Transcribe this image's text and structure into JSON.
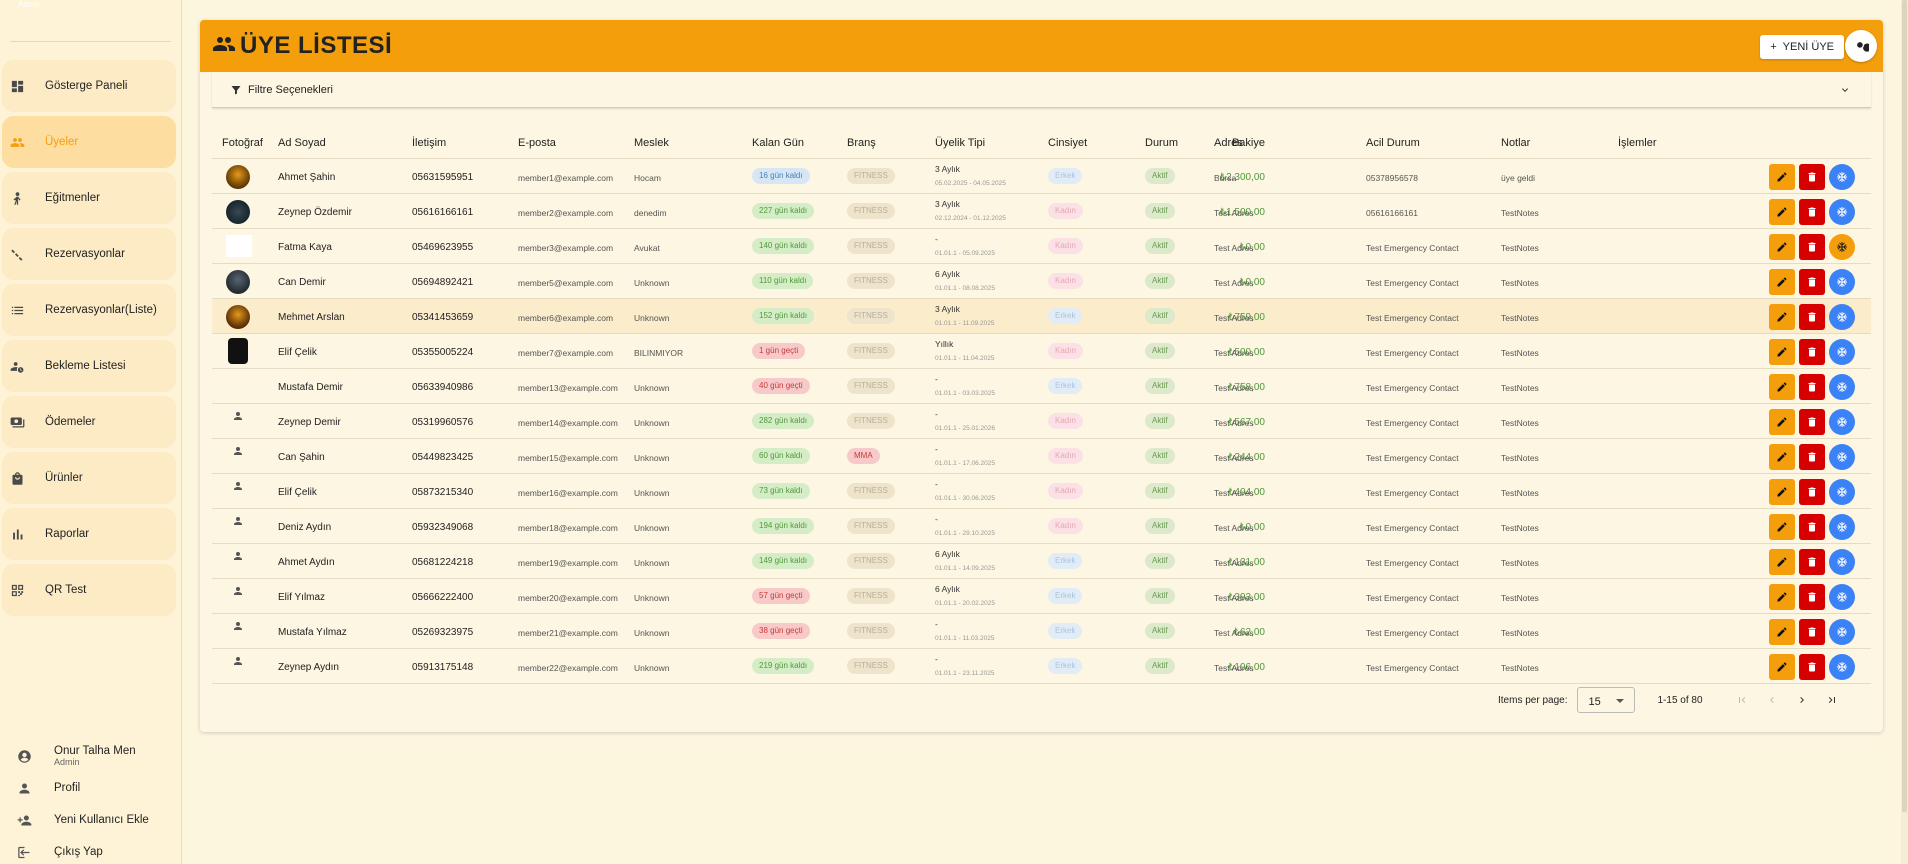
{
  "sidebar": {
    "brand_small": "Admin",
    "items": [
      {
        "label": "Gösterge Paneli",
        "icon": "dashboard-icon",
        "active": false
      },
      {
        "label": "Üyeler",
        "icon": "people-icon",
        "active": true
      },
      {
        "label": "Eğitmenler",
        "icon": "trainer-icon",
        "active": false
      },
      {
        "label": "Rezervasyonlar",
        "icon": "calendar-icon",
        "active": false
      },
      {
        "label": "Rezervasyonlar(Liste)",
        "icon": "list-icon",
        "active": false
      },
      {
        "label": "Bekleme Listesi",
        "icon": "waiting-icon",
        "active": false
      },
      {
        "label": "Ödemeler",
        "icon": "payment-icon",
        "active": false
      },
      {
        "label": "Ürünler",
        "icon": "bag-icon",
        "active": false
      },
      {
        "label": "Raporlar",
        "icon": "chart-icon",
        "active": false
      },
      {
        "label": "QR Test",
        "icon": "qr-icon",
        "active": false
      }
    ],
    "user": {
      "name": "Onur Talha Men",
      "role": "Admin"
    },
    "links": [
      {
        "label": "Profil",
        "icon": "person-icon"
      },
      {
        "label": "Yeni Kullanıcı Ekle",
        "icon": "person-add-icon"
      },
      {
        "label": "Çıkış Yap",
        "icon": "logout-icon"
      }
    ]
  },
  "header": {
    "title": "ÜYE LİSTESİ",
    "new_button": "YENİ ÜYE",
    "accent": "#f59e0b"
  },
  "filter": {
    "label": "Filtre Seçenekleri"
  },
  "table": {
    "columns": [
      "Fotoğraf",
      "Ad Soyad",
      "İletişim",
      "E-posta",
      "Meslek",
      "Kalan Gün",
      "Branş",
      "Üyelik Tipi",
      "Cinsiyet",
      "Bakiye",
      "Durum",
      "Adres",
      "Acil Durum",
      "Notlar",
      "İşlemler"
    ],
    "rows": [
      {
        "photo": "p1",
        "name": "Ahmet Şahin",
        "phone": "05631595951",
        "email": "member1@example.com",
        "job": "Hocam",
        "days": "16 gün kaldı",
        "days_style": "blue",
        "branch": "FITNESS",
        "branch_style": "gray",
        "type": "3 Aylık",
        "dates": "05.02.2025 - 04.05.2025",
        "gender": "Erkek",
        "gender_style": "lblue",
        "balance": "₺2.300,00",
        "status": "Aktif",
        "address": "Bursa",
        "emergency": "05378956578",
        "notes": "üye geldi",
        "freeze": "blue"
      },
      {
        "photo": "p2",
        "name": "Zeynep Özdemir",
        "phone": "05616166161",
        "email": "member2@example.com",
        "job": "denedim",
        "days": "227 gün kaldı",
        "days_style": "green",
        "branch": "FITNESS",
        "branch_style": "gray",
        "type": "3 Aylık",
        "dates": "02.12.2024 - 01.12.2025",
        "gender": "Kadın",
        "gender_style": "pink",
        "balance": "₺1.500,00",
        "status": "Aktif",
        "address": "Test Adres",
        "emergency": "05616166161",
        "notes": "TestNotes",
        "freeze": "blue"
      },
      {
        "photo": "p3",
        "name": "Fatma Kaya",
        "phone": "05469623955",
        "email": "member3@example.com",
        "job": "Avukat",
        "days": "140 gün kaldı",
        "days_style": "green",
        "branch": "FITNESS",
        "branch_style": "gray",
        "type": "-",
        "dates": "01.01.1 - 05.09.2025",
        "gender": "Kadın",
        "gender_style": "pink",
        "balance": "₺0,00",
        "status": "Aktif",
        "address": "Test Adres",
        "emergency": "Test Emergency Contact",
        "notes": "TestNotes",
        "freeze": "orange"
      },
      {
        "photo": "p4",
        "name": "Can Demir",
        "phone": "05694892421",
        "email": "member5@example.com",
        "job": "Unknown",
        "days": "110 gün kaldı",
        "days_style": "green",
        "branch": "FITNESS",
        "branch_style": "gray",
        "type": "6 Aylık",
        "dates": "01.01.1 - 08.08.2025",
        "gender": "Kadın",
        "gender_style": "pink",
        "balance": "₺0,00",
        "status": "Aktif",
        "address": "Test Adres",
        "emergency": "Test Emergency Contact",
        "notes": "TestNotes",
        "freeze": "blue"
      },
      {
        "photo": "p5",
        "name": "Mehmet Arslan",
        "phone": "05341453659",
        "email": "member6@example.com",
        "job": "Unknown",
        "days": "152 gün kaldı",
        "days_style": "green",
        "branch": "FITNESS",
        "branch_style": "gray",
        "type": "3 Aylık",
        "dates": "01.01.1 - 11.09.2025",
        "gender": "Erkek",
        "gender_style": "lblue",
        "balance": "₺759,00",
        "status": "Aktif",
        "address": "Test Adres",
        "emergency": "Test Emergency Contact",
        "notes": "TestNotes",
        "freeze": "blue",
        "highlight": true
      },
      {
        "photo": "p6",
        "name": "Elif Çelik",
        "phone": "05355005224",
        "email": "member7@example.com",
        "job": "BILINMIYOR",
        "days": "1 gün geçti",
        "days_style": "red",
        "branch": "FITNESS",
        "branch_style": "gray",
        "type": "Yıllık",
        "dates": "01.01.1 - 11.04.2025",
        "gender": "Kadın",
        "gender_style": "pink",
        "balance": "₺500,00",
        "status": "Aktif",
        "address": "Test Adres",
        "emergency": "Test Emergency Contact",
        "notes": "TestNotes",
        "freeze": "blue"
      },
      {
        "photo": "p7",
        "name": "Mustafa Demir",
        "phone": "05633940986",
        "email": "member13@example.com",
        "job": "Unknown",
        "days": "40 gün geçti",
        "days_style": "red",
        "branch": "FITNESS",
        "branch_style": "gray",
        "type": "-",
        "dates": "01.01.1 - 03.03.2025",
        "gender": "Erkek",
        "gender_style": "lblue",
        "balance": "₺758,00",
        "status": "Aktif",
        "address": "Test Adres",
        "emergency": "Test Emergency Contact",
        "notes": "TestNotes",
        "freeze": "blue"
      },
      {
        "photo": "icon",
        "name": "Zeynep Demir",
        "phone": "05319960576",
        "email": "member14@example.com",
        "job": "Unknown",
        "days": "282 gün kaldı",
        "days_style": "green",
        "branch": "FITNESS",
        "branch_style": "gray",
        "type": "-",
        "dates": "01.01.1 - 25.01.2026",
        "gender": "Kadın",
        "gender_style": "pink",
        "balance": "₺567,00",
        "status": "Aktif",
        "address": "Test Adres",
        "emergency": "Test Emergency Contact",
        "notes": "TestNotes",
        "freeze": "blue"
      },
      {
        "photo": "icon",
        "name": "Can Şahin",
        "phone": "05449823425",
        "email": "member15@example.com",
        "job": "Unknown",
        "days": "60 gün kaldı",
        "days_style": "green",
        "branch": "MMA",
        "branch_style": "mma",
        "type": "-",
        "dates": "01.01.1 - 17.06.2025",
        "gender": "Kadın",
        "gender_style": "pink",
        "balance": "₺244,00",
        "status": "Aktif",
        "address": "Test Adres",
        "emergency": "Test Emergency Contact",
        "notes": "TestNotes",
        "freeze": "blue"
      },
      {
        "photo": "icon",
        "name": "Elif Çelik",
        "phone": "05873215340",
        "email": "member16@example.com",
        "job": "Unknown",
        "days": "73 gün kaldı",
        "days_style": "green",
        "branch": "FITNESS",
        "branch_style": "gray",
        "type": "-",
        "dates": "01.01.1 - 30.06.2025",
        "gender": "Kadın",
        "gender_style": "pink",
        "balance": "₺404,00",
        "status": "Aktif",
        "address": "Test Adres",
        "emergency": "Test Emergency Contact",
        "notes": "TestNotes",
        "freeze": "blue"
      },
      {
        "photo": "icon",
        "name": "Deniz Aydın",
        "phone": "05932349068",
        "email": "member18@example.com",
        "job": "Unknown",
        "days": "194 gün kaldı",
        "days_style": "green",
        "branch": "FITNESS",
        "branch_style": "gray",
        "type": "-",
        "dates": "01.01.1 - 29.10.2025",
        "gender": "Kadın",
        "gender_style": "pink",
        "balance": "₺0,00",
        "status": "Aktif",
        "address": "Test Adres",
        "emergency": "Test Emergency Contact",
        "notes": "TestNotes",
        "freeze": "blue"
      },
      {
        "photo": "icon",
        "name": "Ahmet Aydın",
        "phone": "05681224218",
        "email": "member19@example.com",
        "job": "Unknown",
        "days": "149 gün kaldı",
        "days_style": "green",
        "branch": "FITNESS",
        "branch_style": "gray",
        "type": "6 Aylık",
        "dates": "01.01.1 - 14.09.2025",
        "gender": "Erkek",
        "gender_style": "lblue",
        "balance": "₺131,00",
        "status": "Aktif",
        "address": "Test Adres",
        "emergency": "Test Emergency Contact",
        "notes": "TestNotes",
        "freeze": "blue"
      },
      {
        "photo": "icon",
        "name": "Elif Yılmaz",
        "phone": "05666222400",
        "email": "member20@example.com",
        "job": "Unknown",
        "days": "57 gün geçti",
        "days_style": "red",
        "branch": "FITNESS",
        "branch_style": "gray",
        "type": "6 Aylık",
        "dates": "01.01.1 - 20.02.2025",
        "gender": "Erkek",
        "gender_style": "lblue",
        "balance": "₺393,00",
        "status": "Aktif",
        "address": "Test Adres",
        "emergency": "Test Emergency Contact",
        "notes": "TestNotes",
        "freeze": "blue"
      },
      {
        "photo": "icon",
        "name": "Mustafa Yılmaz",
        "phone": "05269323975",
        "email": "member21@example.com",
        "job": "Unknown",
        "days": "38 gün geçti",
        "days_style": "red",
        "branch": "FITNESS",
        "branch_style": "gray",
        "type": "-",
        "dates": "01.01.1 - 11.03.2025",
        "gender": "Erkek",
        "gender_style": "lblue",
        "balance": "₺62,00",
        "status": "Aktif",
        "address": "Test Adres",
        "emergency": "Test Emergency Contact",
        "notes": "TestNotes",
        "freeze": "blue"
      },
      {
        "photo": "icon",
        "name": "Zeynep Aydın",
        "phone": "05913175148",
        "email": "member22@example.com",
        "job": "Unknown",
        "days": "219 gün kaldı",
        "days_style": "green",
        "branch": "FITNESS",
        "branch_style": "gray",
        "type": "-",
        "dates": "01.01.1 - 23.11.2025",
        "gender": "Erkek",
        "gender_style": "lblue",
        "balance": "₺106,00",
        "status": "Aktif",
        "address": "Test Adres",
        "emergency": "Test Emergency Contact",
        "notes": "TestNotes",
        "freeze": "blue"
      }
    ]
  },
  "pagination": {
    "items_per_page_label": "Items per page:",
    "items_per_page": "15",
    "range": "1-15 of 80"
  }
}
